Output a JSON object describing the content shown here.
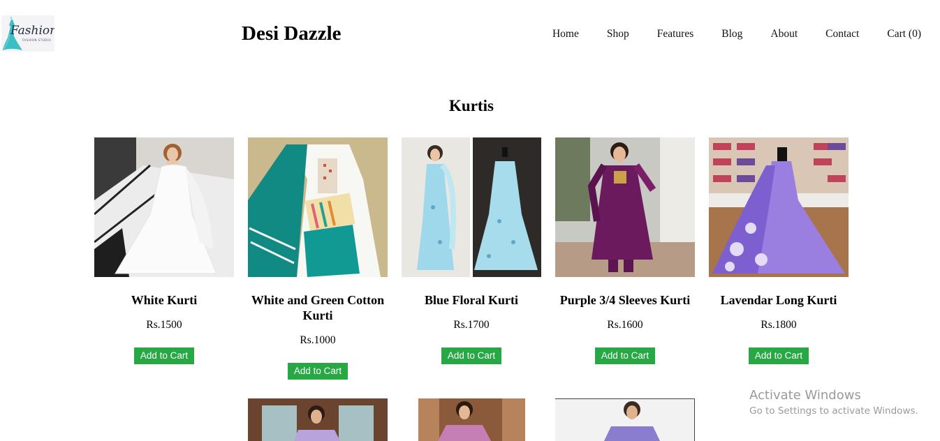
{
  "header": {
    "logo_text": "Fashion",
    "logo_subtext": "FASHION STUDIO",
    "site_title": "Desi Dazzle",
    "nav": [
      "Home",
      "Shop",
      "Features",
      "Blog",
      "About",
      "Contact",
      "Cart (0)"
    ]
  },
  "section": {
    "title": "Kurtis"
  },
  "products": [
    {
      "name": "White Kurti",
      "price": "Rs.1500",
      "button": "Add to Cart"
    },
    {
      "name": "White and Green Cotton Kurti",
      "price": "Rs.1000",
      "button": "Add to Cart"
    },
    {
      "name": "Blue Floral Kurti",
      "price": "Rs.1700",
      "button": "Add to Cart"
    },
    {
      "name": "Purple 3/4 Sleeves Kurti",
      "price": "Rs.1600",
      "button": "Add to Cart"
    },
    {
      "name": "Lavendar Long Kurti",
      "price": "Rs.1800",
      "button": "Add to Cart"
    }
  ],
  "watermark": {
    "title": "Activate Windows",
    "subtitle": "Go to Settings to activate Windows."
  },
  "colors": {
    "button": "#28a745",
    "logo_teal": "#3bbfc4"
  }
}
